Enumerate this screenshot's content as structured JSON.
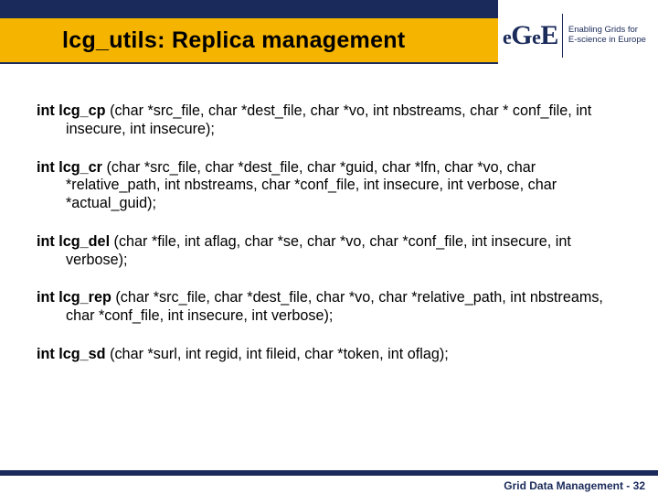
{
  "header": {
    "title": "lcg_utils: Replica management",
    "logo": {
      "mark": "eGee",
      "tagline_l1": "Enabling Grids for",
      "tagline_l2": "E-science in Europe"
    }
  },
  "functions": [
    {
      "ret": "int",
      "name": "lcg_cp",
      "params": " (char *src_file, char *dest_file, char *vo, int nbstreams, char * conf_file, int insecure, int insecure);"
    },
    {
      "ret": "int",
      "name": "lcg_cr",
      "params": " (char *src_file, char *dest_file, char *guid, char *lfn, char *vo, char *relative_path, int nbstreams, char *conf_file, int insecure, int verbose, char *actual_guid);"
    },
    {
      "ret": "int",
      "name": "lcg_del",
      "params": " (char *file, int aflag, char *se, char *vo, char *conf_file, int insecure, int verbose);"
    },
    {
      "ret": "int",
      "name": "lcg_rep",
      "params": " (char *src_file, char *dest_file, char *vo, char *relative_path, int nbstreams, char *conf_file, int insecure, int verbose);"
    },
    {
      "ret": "int",
      "name": "lcg_sd",
      "params": " (char *surl, int regid, int fileid, char *token, int oflag);"
    }
  ],
  "footer": {
    "label": "Grid Data Management",
    "sep": " - ",
    "page": "32"
  }
}
